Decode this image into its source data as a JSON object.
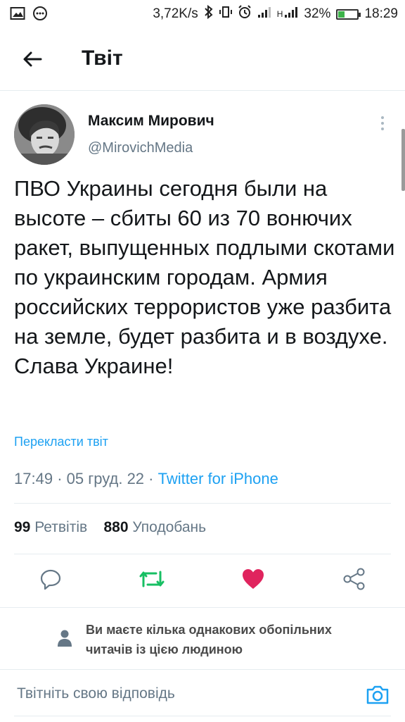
{
  "status_bar": {
    "speed": "3,72K/s",
    "signal_label": "H",
    "battery_percent": 32,
    "battery_text": "32%",
    "time": "18:29"
  },
  "header": {
    "title": "Твіт",
    "back_icon": "arrow-left-icon"
  },
  "tweet": {
    "author_name": "Максим Мирович",
    "author_handle": "@MirovichMedia",
    "text": "ПВО Украины сегодня были на высоте – сбиты 60 из 70 вонючих ракет, выпущенных подлыми скотами по украинским городам. Армия российских террористов уже разбита на земле, будет разбита и в воздухе. Слава Украине!",
    "translate_link": "Перекласти твіт",
    "time": "17:49",
    "date": "05 груд. 22",
    "source": "Twitter for iPhone",
    "retweets_count": "99",
    "retweets_label": "Ретвітів",
    "likes_count": "880",
    "likes_label": "Уподобань"
  },
  "actions": {
    "reply_icon": "reply-icon",
    "retweet_icon": "retweet-icon",
    "like_icon": "heart-icon",
    "share_icon": "share-icon"
  },
  "mutual_followers": {
    "text": "Ви маєте кілька однакових обопільних читачів із цією людиною"
  },
  "reply": {
    "placeholder": "Твітніть свою відповідь"
  },
  "colors": {
    "accent": "#1da1f2",
    "retweet_active": "#17bf63",
    "like_active": "#e0245e",
    "secondary_text": "#657786"
  }
}
